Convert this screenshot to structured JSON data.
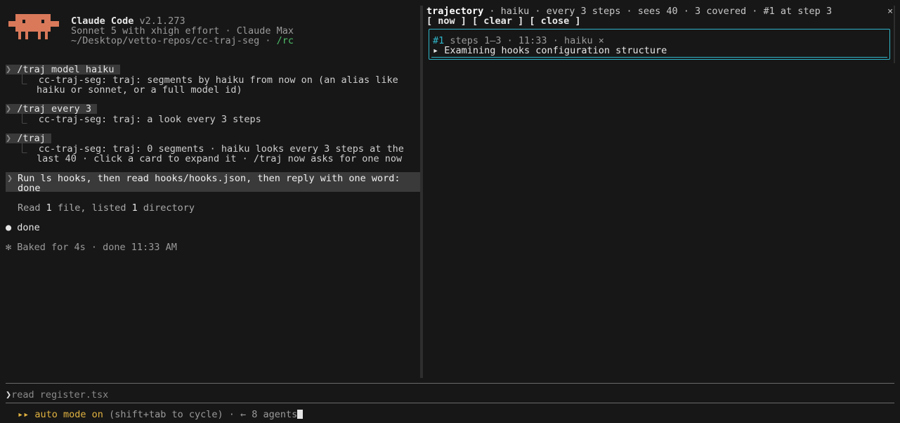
{
  "header": {
    "app_name": "Claude Code",
    "version": "v2.1.273",
    "model_line": "Sonnet 5 with xhigh effort · Claude Max",
    "path": "~/Desktop/vetto-repos/cc-traj-seg · ",
    "remote": "/rc"
  },
  "conversation": {
    "cmd1": "/traj model haiku ",
    "reply1_l1": "cc-traj-seg: traj: segments by haiku from now on (an alias like",
    "reply1_l2": "haiku or sonnet, or a full model id)",
    "cmd2": "/traj every 3 ",
    "reply2": "cc-traj-seg: traj: a look every 3 steps",
    "cmd3": "/traj ",
    "reply3_l1": "cc-traj-seg: traj: 0 segments · haiku looks every 3 steps at the",
    "reply3_l2": "last 40 · click a card to expand it · /traj now asks for one now",
    "prompt_l1": "Run ls hooks, then read hooks/hooks.json, then reply with one word:",
    "prompt_l2": "done",
    "read_prefix": "Read ",
    "read_count1": "1",
    "read_mid": " file, listed ",
    "read_count2": "1",
    "read_suffix": " directory",
    "done_bullet": "●",
    "done_text": "done",
    "baked": "✻ Baked for 4s · done 11:33 AM"
  },
  "trajectory": {
    "title": "trajectory",
    "meta": " · haiku · every 3 steps · sees 40 · 3 covered · #1 at step 3",
    "close": "×",
    "btn_now": "[ now ]",
    "btn_clear": "[ clear ]",
    "btn_close": "[ close ]",
    "card": {
      "number": "#1",
      "meta": " steps 1–3 · 11:33 · haiku ×",
      "summary": "▸ Examining hooks configuration structure"
    }
  },
  "input": {
    "chevron": "❯",
    "placeholder": "read register.tsx"
  },
  "status": {
    "icon": "▸▸",
    "mode": "auto mode on",
    "hint": " (shift+tab to cycle) · ← 8 agents"
  },
  "colors": {
    "background": "#171717",
    "mascot": "#d9795a",
    "accent_cyan": "#2fb6c9",
    "accent_yellow": "#e2b340",
    "accent_green": "#4fbf6a"
  }
}
